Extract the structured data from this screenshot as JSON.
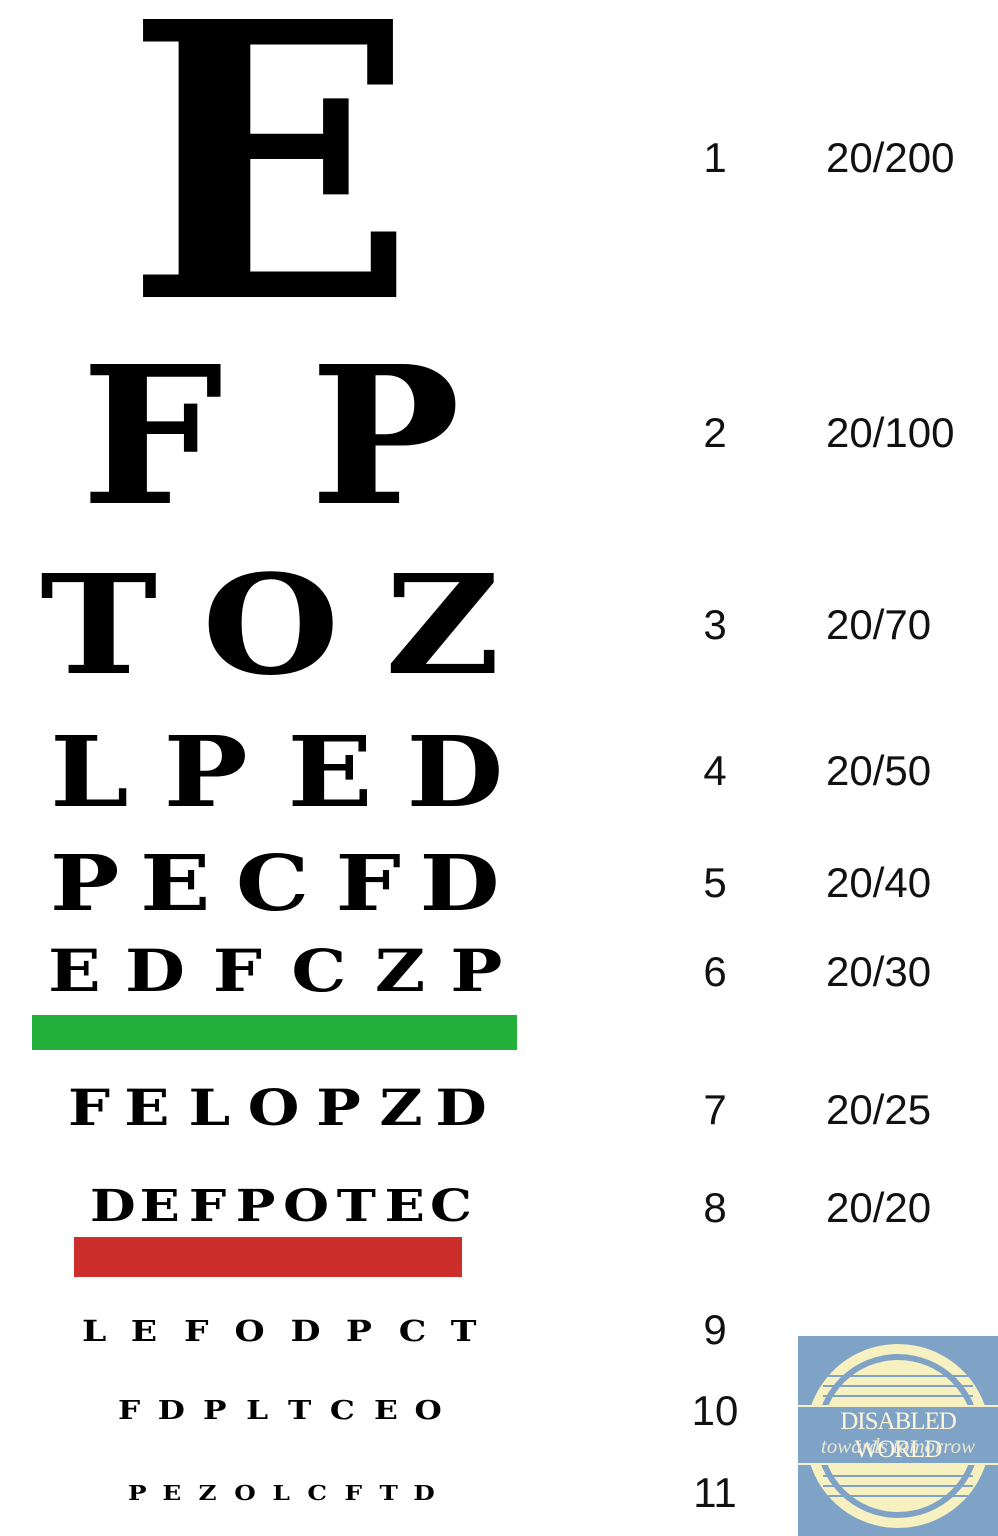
{
  "rows": [
    {
      "line": "1",
      "acuity": "20/200",
      "letters": [
        "E"
      ]
    },
    {
      "line": "2",
      "acuity": "20/100",
      "letters": [
        "F",
        "P"
      ]
    },
    {
      "line": "3",
      "acuity": "20/70",
      "letters": [
        "T",
        "O",
        "Z"
      ]
    },
    {
      "line": "4",
      "acuity": "20/50",
      "letters": [
        "L",
        "P",
        "E",
        "D"
      ]
    },
    {
      "line": "5",
      "acuity": "20/40",
      "letters": [
        "P",
        "E",
        "C",
        "F",
        "D"
      ]
    },
    {
      "line": "6",
      "acuity": "20/30",
      "letters": [
        "E",
        "D",
        "F",
        "C",
        "Z",
        "P"
      ]
    },
    {
      "line": "7",
      "acuity": "20/25",
      "letters": [
        "F",
        "E",
        "L",
        "O",
        "P",
        "Z",
        "D"
      ]
    },
    {
      "line": "8",
      "acuity": "20/20",
      "letters": [
        "D",
        "E",
        "F",
        "P",
        "O",
        "T",
        "E",
        "C"
      ]
    },
    {
      "line": "9",
      "acuity": "",
      "letters": [
        "L",
        "E",
        "F",
        "O",
        "D",
        "P",
        "C",
        "T"
      ]
    },
    {
      "line": "10",
      "acuity": "",
      "letters": [
        "F",
        "D",
        "P",
        "L",
        "T",
        "C",
        "E",
        "O"
      ]
    },
    {
      "line": "11",
      "acuity": "",
      "letters": [
        "P",
        "E",
        "Z",
        "O",
        "L",
        "C",
        "F",
        "T",
        "D"
      ]
    }
  ],
  "bars": {
    "green": "#22b03a",
    "red": "#cc2e2b"
  },
  "logo": {
    "title": "DISABLED WORLD",
    "tagline": "towards tomorrow",
    "background": "#7fa3c6",
    "emblem_color": "#f7f0c0"
  }
}
